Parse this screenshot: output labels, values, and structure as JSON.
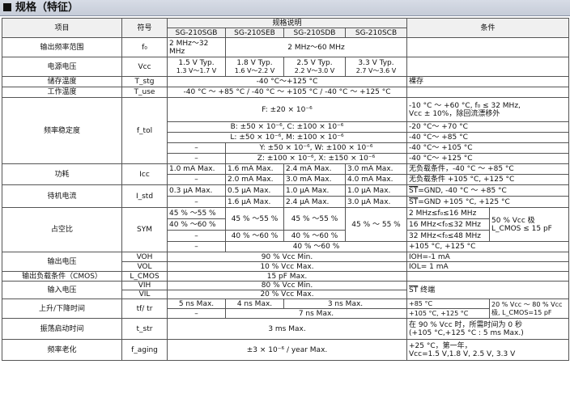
{
  "section_title": "规格（特征）",
  "header": {
    "item": "项目",
    "symbol": "符号",
    "spec_desc": "规格说明",
    "models": [
      "SG-210SGB",
      "SG-210SEB",
      "SG-210SDB",
      "SG-210SCB"
    ],
    "conditions": "条件"
  },
  "freq_range": {
    "label": "输出频率范围",
    "symbol": "f₀",
    "sgb": "2 MHz～32 MHz",
    "others": "2 MHz～60 MHz"
  },
  "supply_voltage": {
    "label": "电源电压",
    "symbol": "Vcc",
    "typ": [
      "1.5 V Typ.",
      "1.8 V Typ.",
      "2.5 V Typ.",
      "3.3 V Typ."
    ],
    "range": [
      "1.3 V～1.7 V",
      "1.6 V～2.2 V",
      "2.2 V～3.0 V",
      "2.7 V～3.6 V"
    ]
  },
  "storage_temp": {
    "label": "储存温度",
    "symbol": "T_stg",
    "value": "-40 °C～+125 °C",
    "condition": "裸存"
  },
  "operating_temp": {
    "label": "工作温度",
    "symbol": "T_use",
    "value": "-40 °C ～ +85 °C / -40 °C ～ +105 °C / -40 °C ～ +125 °C"
  },
  "freq_tol": {
    "label": "频率稳定度",
    "symbol": "f_tol",
    "f_code": "F: ±20 × 10⁻⁶",
    "bc": "B: ±50 × 10⁻⁶, C: ±100 × 10⁻⁶",
    "lm": "L: ±50 × 10⁻⁶, M: ±100 × 10⁻⁶",
    "yw": "Y: ±50 × 10⁻⁶, W: ±100 × 10⁻⁶",
    "zx": "Z: ±100 × 10⁻⁶, X: ±150 × 10⁻⁶",
    "dash": "–",
    "cond_f_1": "-10 °C ～ +60 °C, f₀ ≤ 32 MHz,",
    "cond_f_2": "Vcc ± 10%，除回流漂移外",
    "cond_bc": "-20 °C～ +70 °C",
    "cond_lm": "-40 °C～ +85 °C",
    "cond_yw": "-40 °C～ +105 °C",
    "cond_zx": "-40 °C～ +125 °C"
  },
  "current": {
    "label": "功耗",
    "symbol": "Icc",
    "r1": [
      "1.0 mA Max.",
      "1.6 mA Max.",
      "2.4 mA Max.",
      "3.0 mA Max."
    ],
    "r2": [
      "–",
      "2.0 mA Max.",
      "3.0 mA Max.",
      "4.0 mA Max."
    ],
    "cond1": "无负载条件，-40 °C ～ +85 °C",
    "cond2": "无负载条件 +105 °C, +125 °C"
  },
  "standby": {
    "label": "待机电流",
    "symbol": "I_std",
    "r1": [
      "0.3 μA Max.",
      "0.5 μA Max.",
      "1.0 μA Max.",
      "1.0 μA Max."
    ],
    "r2": [
      "–",
      "1.6 μA Max.",
      "2.4 μA Max.",
      "3.0 μA Max."
    ],
    "st": "ST",
    "cond1": "=GND, -40 °C ～ +85 °C",
    "cond2": "=GND +105 °C, +125 °C"
  },
  "duty": {
    "label": "占空比",
    "symbol": "SYM",
    "sgb1": "45 % ～55 %",
    "sgb2": "40 % ～60 %",
    "dash": "–",
    "seb1": "45 % ～55 %",
    "seb2": "40 % ～60 %",
    "sdb1": "45 % ～55 %",
    "sdb2": "40 % ～60 %",
    "scb1": "45 % ～ 55 %",
    "last": "40 % ～60 %",
    "cond_f1": "2 MHz≤f₀≤16 MHz",
    "cond_f2": "16 MHz<f₀≤32 MHz",
    "cond_f3": "32 MHz<f₀≤48 MHz",
    "cond_temp": "+105 °C, +125 °C",
    "cond_side_1": "50 % Vcc 极",
    "cond_side_2": "L_CMOS ≤ 15 pF"
  },
  "output_voltage": {
    "label": "输出电压",
    "sym_h": "VOH",
    "sym_l": "VOL",
    "val_h": "90 % Vcc Min.",
    "val_l": "10 % Vcc Max.",
    "cond_h": "IOH=-1 mA",
    "cond_l": "IOL= 1 mA"
  },
  "load": {
    "label": "输出负载条件（CMOS）",
    "symbol": "L_CMOS",
    "value": "15 pF Max."
  },
  "input_voltage": {
    "label": "输入电压",
    "sym_h": "VIH",
    "sym_l": "VIL",
    "val_h": "80 % Vcc Min.",
    "val_l": "20 % Vcc Max.",
    "st": "ST",
    "cond": " 终端"
  },
  "rise_fall": {
    "label": "上升/下降时间",
    "symbol": "tf/ tr",
    "sgb": "5 ns Max.",
    "seb": "4 ns Max.",
    "sdb_scb": "3 ns Max.",
    "r2_dash": "–",
    "r2": "7 ns Max.",
    "cond1": "+85 °C",
    "cond2": "+105 °C, +125 °C",
    "side1": "20 % Vcc ～ 80 % Vcc",
    "side2": "极, L_CMOS=15 pF"
  },
  "startup": {
    "label": "振荡启动时间",
    "symbol": "t_str",
    "value": "3 ms Max.",
    "cond1": "在 90 % Vcc 时，所需时间为 0 秒",
    "cond2": "(+105 °C,+125 °C : 5 ms Max.)"
  },
  "aging": {
    "label": "频率老化",
    "symbol": "f_aging",
    "value": "±3 × 10⁻⁶ / year Max.",
    "cond1": "+25 °C，第一年，",
    "cond2": "Vcc=1.5 V,1.8 V, 2.5 V, 3.3 V"
  }
}
